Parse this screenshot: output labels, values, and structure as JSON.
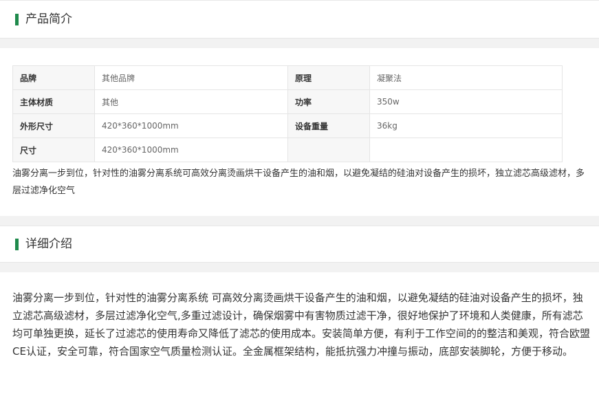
{
  "intro": {
    "title": "产品简介",
    "specs": [
      [
        {
          "key": "品牌",
          "value": "其他品牌"
        },
        {
          "key": "原理",
          "value": "凝聚法"
        }
      ],
      [
        {
          "key": "主体材质",
          "value": "其他"
        },
        {
          "key": "功率",
          "value": "350w"
        }
      ],
      [
        {
          "key": "外形尺寸",
          "value": "420*360*1000mm"
        },
        {
          "key": "设备重量",
          "value": "36kg"
        }
      ],
      [
        {
          "key": "尺寸",
          "value": "420*360*1000mm"
        },
        {
          "key": "",
          "value": ""
        }
      ]
    ],
    "summary": "油雾分离一步到位，针对性的油雾分离系统可高效分离烫画烘干设备产生的油和烟，以避免凝结的硅油对设备产生的损坏，独立滤芯高级滤材，多层过滤净化空气"
  },
  "detail": {
    "title": "详细介绍",
    "text": "油雾分离一步到位，针对性的油雾分离系统 可高效分离烫画烘干设备产生的油和烟，以避免凝结的硅油对设备产生的损坏，独立滤芯高级滤材，多层过滤净化空气,多重过滤设计，确保烟雾中有害物质过滤干净，很好地保护了环境和人类健康，所有滤芯均可单独更换，延长了过滤芯的使用寿命又降低了滤芯的使用成本。安装简单方便，有利于工作空间的的整洁和美观，符合欧盟CE认证，安全可靠，符合国家空气质量检测认证。全金属框架结构，能抵抗强力冲撞与振动，底部安装脚轮，方便于移动。"
  },
  "colors": {
    "accent": "#1f8a4c"
  }
}
